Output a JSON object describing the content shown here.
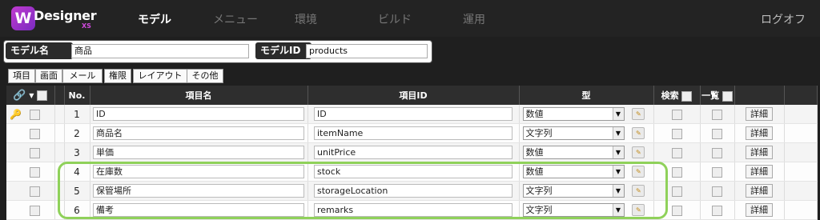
{
  "header": {
    "logo_text": "Designer",
    "logo_mark": "W",
    "logo_version": "XS",
    "nav": [
      "モデル",
      "メニュー",
      "環境",
      "ビルド",
      "運用"
    ],
    "active_nav": "モデル",
    "logout": "ログオフ"
  },
  "model": {
    "name_label": "モデル名",
    "name_value": "商品",
    "id_label": "モデルID",
    "id_value": "products"
  },
  "tabs": [
    "項目",
    "画面",
    "メール",
    "権限",
    "レイアウト",
    "その他"
  ],
  "grid": {
    "headers": {
      "no": "No.",
      "name": "項目名",
      "id": "項目ID",
      "type": "型",
      "search": "検索",
      "list": "一覧"
    },
    "detail_label": "詳細",
    "rows": [
      {
        "no": "1",
        "name": "ID",
        "id": "ID",
        "type": "数値",
        "key": true
      },
      {
        "no": "2",
        "name": "商品名",
        "id": "itemName",
        "type": "文字列",
        "key": false
      },
      {
        "no": "3",
        "name": "単価",
        "id": "unitPrice",
        "type": "数値",
        "key": false
      },
      {
        "no": "4",
        "name": "在庫数",
        "id": "stock",
        "type": "数値",
        "key": false
      },
      {
        "no": "5",
        "name": "保管場所",
        "id": "storageLocation",
        "type": "文字列",
        "key": false
      },
      {
        "no": "6",
        "name": "備考",
        "id": "remarks",
        "type": "文字列",
        "key": false
      }
    ]
  },
  "colors": {
    "header_bg": "#2e2e2e",
    "highlight": "#8fd15a",
    "logo": "#c03ad0"
  }
}
